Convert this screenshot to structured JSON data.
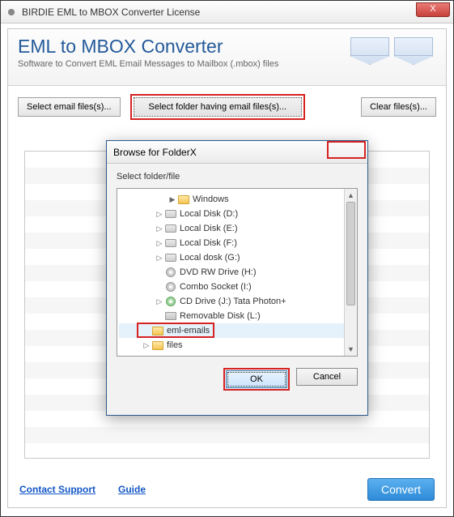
{
  "window": {
    "title": "BIRDIE EML to MBOX Converter License",
    "close_x": "X"
  },
  "header": {
    "title": "EML to MBOX Converter",
    "subtitle": "Software to Convert EML Email Messages to Mailbox (.mbox) files"
  },
  "toolbar": {
    "select_files": "Select email files(s)...",
    "select_folder": "Select folder having email files(s)...",
    "clear_files": "Clear files(s)..."
  },
  "footer": {
    "contact": "Contact Support",
    "guide": "Guide",
    "convert": "Convert"
  },
  "dialog": {
    "title": "Browse for Folder",
    "label": "Select folder/file",
    "ok": "OK",
    "cancel": "Cancel",
    "selected": "eml-emails",
    "tree": [
      {
        "label": "Windows",
        "type": "folder",
        "indent": 3,
        "arrow": "▶"
      },
      {
        "label": "Local Disk (D:)",
        "type": "disk",
        "indent": 2,
        "arrow": "▷"
      },
      {
        "label": "Local Disk (E:)",
        "type": "disk",
        "indent": 2,
        "arrow": "▷"
      },
      {
        "label": "Local Disk (F:)",
        "type": "disk",
        "indent": 2,
        "arrow": "▷"
      },
      {
        "label": "Local dosk  (G:)",
        "type": "disk",
        "indent": 2,
        "arrow": "▷"
      },
      {
        "label": "DVD RW Drive (H:)",
        "type": "dvd",
        "indent": 2,
        "arrow": ""
      },
      {
        "label": "Combo Socket (I:)",
        "type": "dvd",
        "indent": 2,
        "arrow": ""
      },
      {
        "label": "CD Drive (J:) Tata Photon+",
        "type": "cd",
        "indent": 2,
        "arrow": "▷"
      },
      {
        "label": "Removable Disk (L:)",
        "type": "usb",
        "indent": 2,
        "arrow": ""
      },
      {
        "label": "eml-emails",
        "type": "folder",
        "indent": 1,
        "arrow": "",
        "selected": true
      },
      {
        "label": "files",
        "type": "folder",
        "indent": 1,
        "arrow": "▷"
      }
    ]
  }
}
